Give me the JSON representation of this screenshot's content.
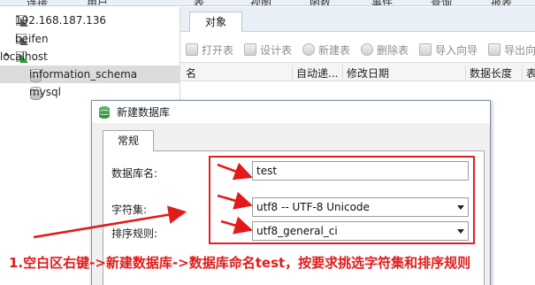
{
  "menubar": {
    "items": [
      "连接",
      "用户",
      "表",
      "视图",
      "函数",
      "事件",
      "查询",
      "报表"
    ]
  },
  "tree": {
    "connections": [
      {
        "label": "192.168.187.136",
        "icon": "mysql-connection-icon",
        "active": false
      },
      {
        "label": "beifen",
        "icon": "mysql-connection-icon",
        "active": false
      },
      {
        "label": "localhost",
        "icon": "mysql-connection-icon",
        "active": true
      }
    ],
    "databases": [
      {
        "label": "information_schema",
        "selected": true
      },
      {
        "label": "mysql",
        "selected": false
      }
    ]
  },
  "objects_panel": {
    "tab": "对象",
    "toolbar": {
      "open_table": "打开表",
      "design_table": "设计表",
      "new_table": "新建表",
      "delete_table": "删除表",
      "import_wizard": "导入向导",
      "export_wizard": "导出向导"
    },
    "columns": [
      "名",
      "自动递...",
      "修改日期",
      "数据长度",
      "表"
    ]
  },
  "dialog": {
    "title": "新建数据库",
    "tab": "常规",
    "db_name_label": "数据库名:",
    "db_name_value": "test",
    "charset_label": "字符集:",
    "charset_value": "utf8 -- UTF-8 Unicode",
    "collation_label": "排序规则:",
    "collation_value": "utf8_general_ci"
  },
  "annotation": {
    "caption": "1.空白区右键->新建数据库->数据库命名test，按要求挑选字符集和排序规则",
    "color": "#e21a1a"
  }
}
